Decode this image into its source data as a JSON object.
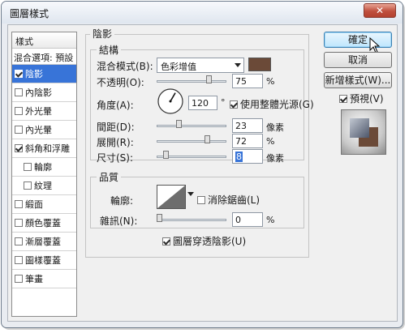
{
  "window": {
    "title": "圖層樣式",
    "close_label": "✕"
  },
  "sidebar": {
    "header": "樣式",
    "blend_default": "混合選項: 預設",
    "items": [
      {
        "label": "陰影",
        "checked": true,
        "selected": true
      },
      {
        "label": "內陰影",
        "checked": false
      },
      {
        "label": "外光暈",
        "checked": false
      },
      {
        "label": "內光暈",
        "checked": false
      },
      {
        "label": "斜角和浮雕",
        "checked": true
      },
      {
        "label": "輪廓",
        "checked": false,
        "indent": true
      },
      {
        "label": "紋理",
        "checked": false,
        "indent": true
      },
      {
        "label": "緞面",
        "checked": false
      },
      {
        "label": "顏色覆蓋",
        "checked": false
      },
      {
        "label": "漸層覆蓋",
        "checked": false
      },
      {
        "label": "圖樣覆蓋",
        "checked": false
      },
      {
        "label": "筆畫",
        "checked": false
      }
    ]
  },
  "shadow": {
    "title": "陰影",
    "structure": {
      "title": "結構",
      "blend_mode_label": "混合模式(B):",
      "blend_mode_value": "色彩增值",
      "color": "#6b4a38",
      "opacity_label": "不透明(O):",
      "opacity_value": "75",
      "opacity_unit": "%",
      "opacity_level": 0.75,
      "angle_label": "角度(A):",
      "angle_value": "120",
      "angle_unit": "°",
      "global_light_label": "使用整體光源(G)",
      "global_light_checked": true,
      "distance_label": "間距(D):",
      "distance_value": "23",
      "distance_unit": "像素",
      "spread_label": "展開(R):",
      "spread_value": "72",
      "spread_unit": "%",
      "size_label": "尺寸(S):",
      "size_value": "8",
      "size_unit": "像素"
    },
    "quality": {
      "title": "品質",
      "contour_label": "輪廓:",
      "anti_alias_label": "消除鋸齒(L)",
      "anti_alias_checked": false,
      "noise_label": "雜訊(N):",
      "noise_value": "0",
      "noise_unit": "%",
      "knockout_label": "圖層穿透陰影(U)",
      "knockout_checked": true
    }
  },
  "buttons": {
    "ok": "確定",
    "cancel": "取消",
    "new_style": "新增樣式(W)...",
    "preview_label": "預視(V)",
    "preview_checked": true
  }
}
